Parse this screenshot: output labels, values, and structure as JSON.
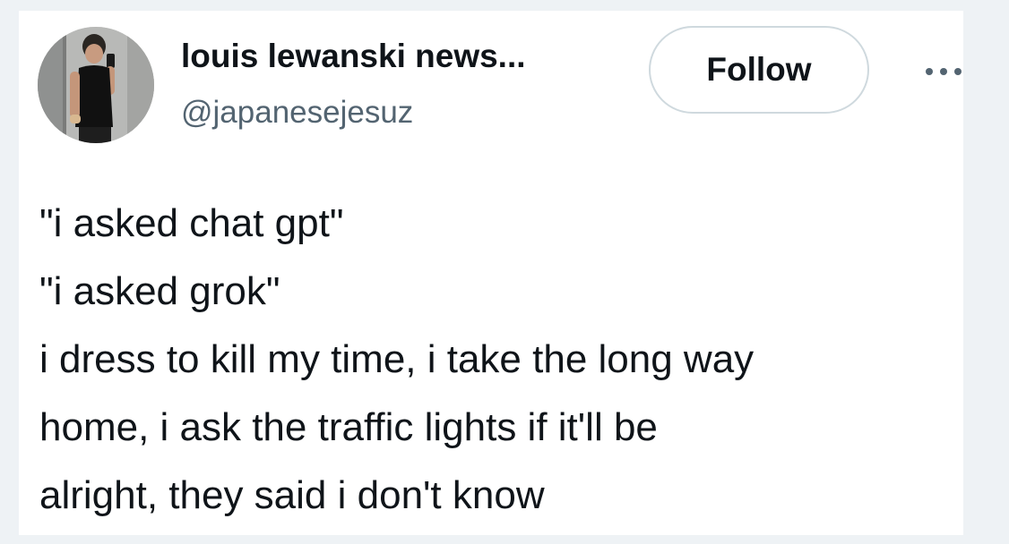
{
  "author": {
    "display_name": "louis lewanski news...",
    "handle": "@japanesejesuz",
    "avatar_icon": "profile-photo"
  },
  "actions": {
    "follow_label": "Follow",
    "more_icon": "more-horizontal-icon"
  },
  "tweet": {
    "lines": [
      "\"i asked chat gpt\"",
      "\"i asked grok\"",
      "i dress to kill my time, i take the long way",
      "home, i ask the traffic lights if it'll be",
      "alright, they said i don't know"
    ]
  },
  "colors": {
    "text_primary": "#0f1419",
    "text_secondary": "#536471",
    "border": "#cfd9de",
    "background": "#eef2f5"
  }
}
